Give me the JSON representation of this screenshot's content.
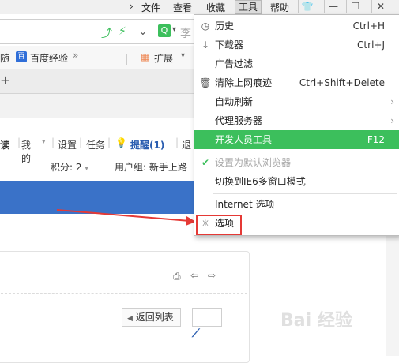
{
  "menubar": {
    "items": [
      "文件",
      "查看",
      "收藏",
      "工具",
      "帮助"
    ],
    "window_buttons": [
      "👕",
      "—",
      "❐",
      "✕"
    ]
  },
  "address": {
    "search_text": "李"
  },
  "favorites": {
    "left_cut": "随",
    "baidu_label": "百度经验",
    "more_icon": "»",
    "extension_label": "扩展"
  },
  "page": {
    "nav_links": [
      "读",
      "我的",
      "设置",
      "任务"
    ],
    "reminder_label": "提醒(1)",
    "logout_cut": "退",
    "points": "积分: 2",
    "usergroup": "用户组: 新手上路",
    "back_to_list": "返回列表"
  },
  "dropdown": {
    "history": {
      "label": "历史",
      "shortcut": "Ctrl+H"
    },
    "downloads": {
      "label": "下载器",
      "shortcut": "Ctrl+J"
    },
    "adblock": {
      "label": "广告过滤"
    },
    "clear_traces": {
      "label": "清除上网痕迹",
      "shortcut": "Ctrl+Shift+Delete"
    },
    "auto_refresh": {
      "label": "自动刷新"
    },
    "proxy": {
      "label": "代理服务器"
    },
    "devtools": {
      "label": "开发人员工具",
      "shortcut": "F12"
    },
    "set_default": {
      "label": "设置为默认浏览器"
    },
    "ie6_mode": {
      "label": "切换到IE6多窗口模式"
    },
    "internet_options": {
      "label": "Internet 选项"
    },
    "options": {
      "label": "选项"
    }
  },
  "watermark": "Bai 经验",
  "colors": {
    "accent_green": "#3cbf5c",
    "page_blue": "#3a72c8",
    "highlight_red": "#e53935"
  }
}
